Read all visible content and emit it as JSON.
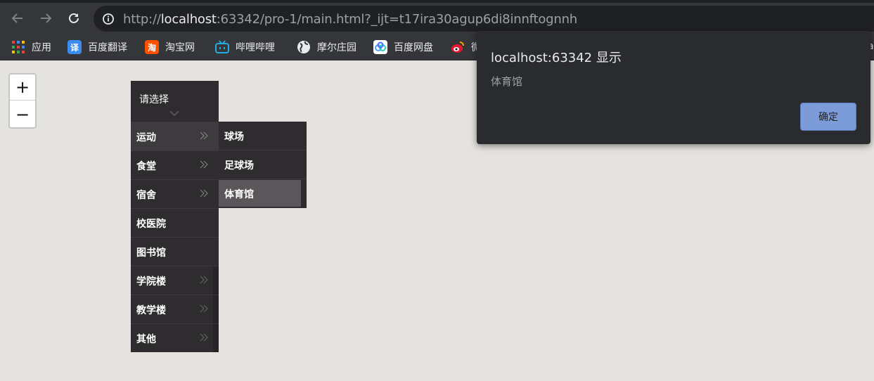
{
  "browser": {
    "url_scheme": "http://",
    "url_host": "localhost",
    "url_rest": ":63342/pro-1/main.html?_ijt=t17ira30agup6di8innftognnh",
    "bookmarks": [
      {
        "label": "应用",
        "icon": "apps-grid-icon"
      },
      {
        "label": "百度翻译",
        "icon": "baidu-translate-icon",
        "glyph": "译",
        "color": "#3b8cf1"
      },
      {
        "label": "淘宝网",
        "icon": "taobao-icon",
        "glyph": "淘",
        "color": "#ff5000"
      },
      {
        "label": "哔哩哔哩",
        "icon": "bilibili-icon",
        "color": "#23ade5"
      },
      {
        "label": "摩尔庄园",
        "icon": "globe-icon"
      },
      {
        "label": "百度网盘",
        "icon": "baidu-netdisk-icon",
        "color": "#4aa3ff"
      },
      {
        "label": "微",
        "icon": "weibo-icon",
        "color": "#e6162d"
      }
    ],
    "bookmark_edge_text": "a"
  },
  "map": {
    "zoom_in": "+",
    "zoom_out": "−"
  },
  "menu": {
    "header": "请选择",
    "items": [
      {
        "label": "运动",
        "has_sub": true
      },
      {
        "label": "食堂",
        "has_sub": true
      },
      {
        "label": "宿舍",
        "has_sub": true
      },
      {
        "label": "校医院",
        "has_sub": false
      },
      {
        "label": "图书馆",
        "has_sub": false
      },
      {
        "label": "学院楼",
        "has_sub": true
      },
      {
        "label": "教学楼",
        "has_sub": true
      },
      {
        "label": "其他",
        "has_sub": true
      }
    ],
    "submenu": [
      {
        "label": "球场"
      },
      {
        "label": "足球场"
      },
      {
        "label": "体育馆",
        "selected": true
      }
    ]
  },
  "dialog": {
    "title": "localhost:63342 显示",
    "message": "体育馆",
    "ok_label": "确定"
  }
}
